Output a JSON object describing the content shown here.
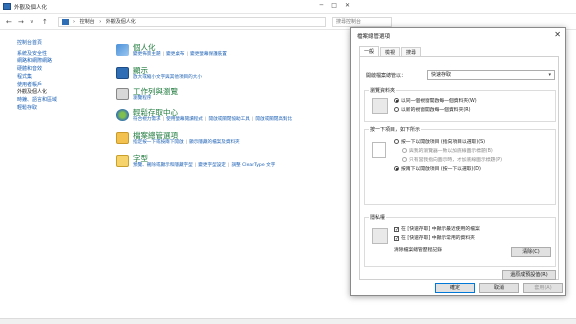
{
  "window": {
    "title": "外觀及個人化",
    "controls": [
      "─",
      "□",
      "✕"
    ]
  },
  "navbar": {
    "back": "←",
    "forward": "→",
    "dropdown": "∨",
    "up": "↑",
    "breadcrumbs": [
      "›",
      "控制台",
      "›",
      "外觀及個人化"
    ],
    "search_placeholder": "搜尋控制台"
  },
  "sidebar": {
    "items": [
      {
        "label": "控制台首頁"
      },
      {
        "label": "系統及安全性"
      },
      {
        "label": "網路和網際網路"
      },
      {
        "label": "硬體和音效"
      },
      {
        "label": "程式集"
      },
      {
        "label": "使用者帳戶"
      },
      {
        "label": "外觀及個人化"
      },
      {
        "label": "時鐘、語言和區域"
      },
      {
        "label": "輕鬆存取"
      }
    ]
  },
  "categories": [
    {
      "title": "個人化",
      "links": [
        "變更佈景主題",
        "變更桌布",
        "變更螢幕保護裝置"
      ]
    },
    {
      "title": "顯示",
      "links": [
        "放大或縮小文字與其他項目的大小"
      ]
    },
    {
      "title": "工作列與瀏覽",
      "links": [
        "瀏覽程序"
      ]
    },
    {
      "title": "輕鬆存取中心",
      "links": [
        "符合視力需求",
        "使用螢幕閱讀程式",
        "開啟或關閉協助工具",
        "開啟或關閉高對比"
      ]
    },
    {
      "title": "檔案總管選項",
      "links": [
        "指定按一下或按兩下開啟",
        "顯示隱藏的檔案及資料夾"
      ]
    },
    {
      "title": "字型",
      "links": [
        "預覽、刪除或顯示和隱藏字型",
        "變更字型設定",
        "調整 ClearType 文字"
      ]
    }
  ],
  "dialog": {
    "title": "檔案總管選項",
    "close": "✕",
    "tabs": [
      {
        "label": "一般"
      },
      {
        "label": "檢視"
      },
      {
        "label": "搜尋"
      }
    ],
    "open_label": "開啟檔案總管以：",
    "open_value": "快速存取",
    "browse": {
      "title": "瀏覽資料夾",
      "options": [
        {
          "label": "以同一個視窗開啟每一個資料夾(W)"
        },
        {
          "label": "以新的視窗開啟每一個資料夾(R)"
        }
      ]
    },
    "click": {
      "title": "按一下項目，如下所示",
      "options": [
        {
          "label": "按一下以開啟項目 (指向項目以選取)(S)"
        },
        {
          "label": "與我的瀏覽器一致以加底線圖示標題(B)"
        },
        {
          "label": "只有當我指向圖示時，才加底線圖示標題(P)"
        },
        {
          "label": "按兩下以開啟項目 (按一下以選取)(D)"
        }
      ]
    },
    "privacy": {
      "title": "隱私權",
      "checks": [
        {
          "label": "在 [快速存取] 中顯示最近使用的檔案"
        },
        {
          "label": "在 [快速存取] 中顯示常用的資料夾"
        }
      ],
      "clear_label": "清除檔案總管歷程記錄",
      "clear_button": "清除(C)"
    },
    "restore_button": "還原成預設值(R)",
    "ok_button": "確定",
    "cancel_button": "取消",
    "apply_button": "套用(A)"
  },
  "colors": {
    "link": "#1a5fb4",
    "category_title": "#1e7a3c",
    "accent": "#0078d7"
  }
}
